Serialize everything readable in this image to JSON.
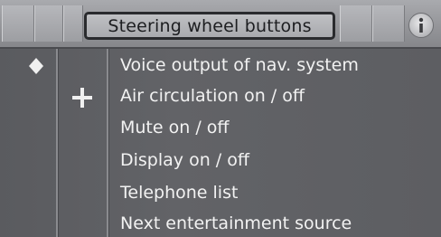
{
  "header": {
    "title": "Steering wheel buttons",
    "info_glyph": "i"
  },
  "list": {
    "items": [
      {
        "label": "Voice output of nav. system",
        "marker": "diamond-icon"
      },
      {
        "label": "Air circulation on / off",
        "marker": "plus-icon"
      },
      {
        "label": "Mute on / off",
        "marker": ""
      },
      {
        "label": "Display on / off",
        "marker": ""
      },
      {
        "label": "Telephone list",
        "marker": ""
      },
      {
        "label": "Next entertainment source",
        "marker": ""
      }
    ]
  },
  "colors": {
    "background": "#5f6064",
    "header": "#9d9ea2",
    "text": "#f2f2f2",
    "title_border": "#2a2b2e"
  }
}
